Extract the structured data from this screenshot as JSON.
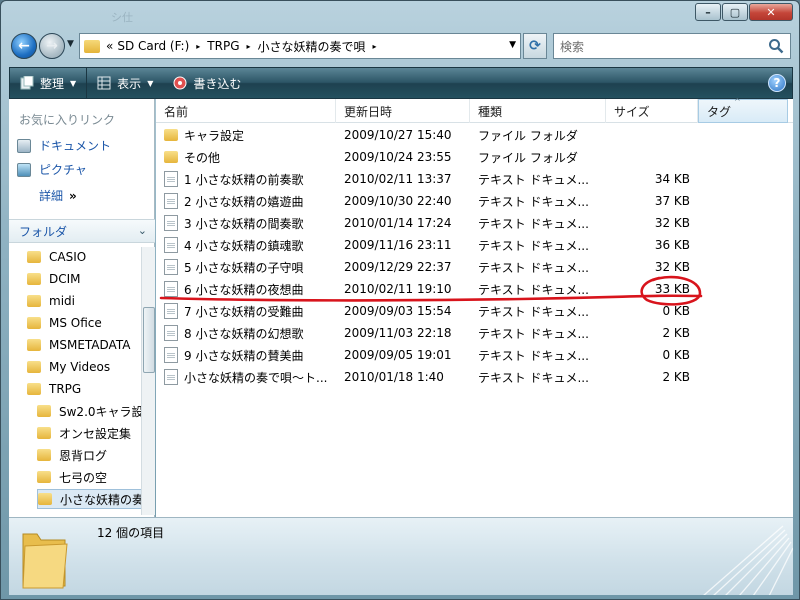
{
  "window": {
    "ghost_title": "シ仕"
  },
  "caption": {
    "minimize": "–",
    "maximize": "▢",
    "close": "✕"
  },
  "nav": {
    "back_glyph": "←",
    "forward_glyph": "→",
    "dropdown_glyph": "▼"
  },
  "address": {
    "overflow": "«",
    "crumbs": [
      "SD Card (F:)",
      "TRPG",
      "小さな妖精の奏で唄"
    ],
    "separator": "▸",
    "dropdown_glyph": "▼"
  },
  "refresh_glyph": "⟳",
  "search": {
    "placeholder": "検索"
  },
  "toolbar": {
    "organize_label": "整理",
    "views_label": "表示",
    "burn_label": "書き込む",
    "caret": "▼",
    "help": "?"
  },
  "navpane": {
    "favorites_header": "お気に入りリンク",
    "favorites": [
      "ドキュメント",
      "ピクチャ"
    ],
    "more_label": "詳細",
    "more_glyph": "»",
    "folders_header": "フォルダ",
    "folders_caret": "⌄",
    "tree": [
      {
        "label": "CASIO",
        "indent": 1
      },
      {
        "label": "DCIM",
        "indent": 1
      },
      {
        "label": "midi",
        "indent": 1
      },
      {
        "label": "MS Ofice",
        "indent": 1
      },
      {
        "label": "MSMETADATA",
        "indent": 1
      },
      {
        "label": "My Videos",
        "indent": 1
      },
      {
        "label": "TRPG",
        "indent": 1
      },
      {
        "label": "Sw2.0キャラ設",
        "indent": 2
      },
      {
        "label": "オンセ設定集",
        "indent": 2
      },
      {
        "label": "恩背ログ",
        "indent": 2
      },
      {
        "label": "七弓の空",
        "indent": 2
      },
      {
        "label": "小さな妖精の奏",
        "indent": 2,
        "selected": true
      }
    ]
  },
  "filelist": {
    "columns": {
      "name": "名前",
      "date": "更新日時",
      "type": "種類",
      "size": "サイズ",
      "tag": "タグ"
    },
    "sort_glyph": "^",
    "rows": [
      {
        "icon": "folder",
        "name": "キャラ設定",
        "date": "2009/10/27 15:40",
        "type": "ファイル フォルダ",
        "size": ""
      },
      {
        "icon": "folder",
        "name": "その他",
        "date": "2009/10/24 23:55",
        "type": "ファイル フォルダ",
        "size": ""
      },
      {
        "icon": "text",
        "name": "1 小さな妖精の前奏歌",
        "date": "2010/02/11 13:37",
        "type": "テキスト ドキュメ...",
        "size": "34 KB"
      },
      {
        "icon": "text",
        "name": "2 小さな妖精の嬉遊曲",
        "date": "2009/10/30 22:40",
        "type": "テキスト ドキュメ...",
        "size": "37 KB"
      },
      {
        "icon": "text",
        "name": "3 小さな妖精の間奏歌",
        "date": "2010/01/14 17:24",
        "type": "テキスト ドキュメ...",
        "size": "32 KB"
      },
      {
        "icon": "text",
        "name": "4 小さな妖精の鎮魂歌",
        "date": "2009/11/16 23:11",
        "type": "テキスト ドキュメ...",
        "size": "36 KB"
      },
      {
        "icon": "text",
        "name": "5 小さな妖精の子守唄",
        "date": "2009/12/29 22:37",
        "type": "テキスト ドキュメ...",
        "size": "32 KB"
      },
      {
        "icon": "text",
        "name": "6 小さな妖精の夜想曲",
        "date": "2010/02/11 19:10",
        "type": "テキスト ドキュメ...",
        "size": "33 KB"
      },
      {
        "icon": "text",
        "name": "7 小さな妖精の受難曲",
        "date": "2009/09/03 15:54",
        "type": "テキスト ドキュメ...",
        "size": "0 KB"
      },
      {
        "icon": "text",
        "name": "8 小さな妖精の幻想歌",
        "date": "2009/11/03 22:18",
        "type": "テキスト ドキュメ...",
        "size": "2 KB"
      },
      {
        "icon": "text",
        "name": "9 小さな妖精の賛美曲",
        "date": "2009/09/05 19:01",
        "type": "テキスト ドキュメ...",
        "size": "0 KB"
      },
      {
        "icon": "text",
        "name": "小さな妖精の奏で唄～ト...",
        "date": "2010/01/18 1:40",
        "type": "テキスト ドキュメ...",
        "size": "2 KB"
      }
    ]
  },
  "details": {
    "item_count": "12 個の項目"
  },
  "colors": {
    "annotation": "#d8141c",
    "link": "#1a55a8",
    "toolbar": "#2c5566"
  }
}
